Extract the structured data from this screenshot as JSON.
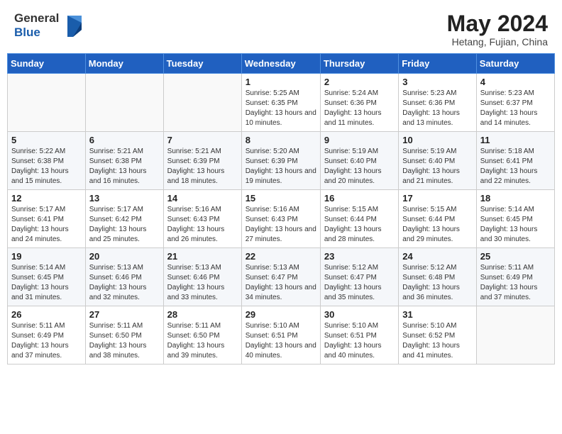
{
  "header": {
    "logo_line1": "General",
    "logo_line2": "Blue",
    "month": "May 2024",
    "location": "Hetang, Fujian, China"
  },
  "weekdays": [
    "Sunday",
    "Monday",
    "Tuesday",
    "Wednesday",
    "Thursday",
    "Friday",
    "Saturday"
  ],
  "weeks": [
    [
      {
        "day": "",
        "text": ""
      },
      {
        "day": "",
        "text": ""
      },
      {
        "day": "",
        "text": ""
      },
      {
        "day": "1",
        "text": "Sunrise: 5:25 AM\nSunset: 6:35 PM\nDaylight: 13 hours and 10 minutes."
      },
      {
        "day": "2",
        "text": "Sunrise: 5:24 AM\nSunset: 6:36 PM\nDaylight: 13 hours and 11 minutes."
      },
      {
        "day": "3",
        "text": "Sunrise: 5:23 AM\nSunset: 6:36 PM\nDaylight: 13 hours and 13 minutes."
      },
      {
        "day": "4",
        "text": "Sunrise: 5:23 AM\nSunset: 6:37 PM\nDaylight: 13 hours and 14 minutes."
      }
    ],
    [
      {
        "day": "5",
        "text": "Sunrise: 5:22 AM\nSunset: 6:38 PM\nDaylight: 13 hours and 15 minutes."
      },
      {
        "day": "6",
        "text": "Sunrise: 5:21 AM\nSunset: 6:38 PM\nDaylight: 13 hours and 16 minutes."
      },
      {
        "day": "7",
        "text": "Sunrise: 5:21 AM\nSunset: 6:39 PM\nDaylight: 13 hours and 18 minutes."
      },
      {
        "day": "8",
        "text": "Sunrise: 5:20 AM\nSunset: 6:39 PM\nDaylight: 13 hours and 19 minutes."
      },
      {
        "day": "9",
        "text": "Sunrise: 5:19 AM\nSunset: 6:40 PM\nDaylight: 13 hours and 20 minutes."
      },
      {
        "day": "10",
        "text": "Sunrise: 5:19 AM\nSunset: 6:40 PM\nDaylight: 13 hours and 21 minutes."
      },
      {
        "day": "11",
        "text": "Sunrise: 5:18 AM\nSunset: 6:41 PM\nDaylight: 13 hours and 22 minutes."
      }
    ],
    [
      {
        "day": "12",
        "text": "Sunrise: 5:17 AM\nSunset: 6:41 PM\nDaylight: 13 hours and 24 minutes."
      },
      {
        "day": "13",
        "text": "Sunrise: 5:17 AM\nSunset: 6:42 PM\nDaylight: 13 hours and 25 minutes."
      },
      {
        "day": "14",
        "text": "Sunrise: 5:16 AM\nSunset: 6:43 PM\nDaylight: 13 hours and 26 minutes."
      },
      {
        "day": "15",
        "text": "Sunrise: 5:16 AM\nSunset: 6:43 PM\nDaylight: 13 hours and 27 minutes."
      },
      {
        "day": "16",
        "text": "Sunrise: 5:15 AM\nSunset: 6:44 PM\nDaylight: 13 hours and 28 minutes."
      },
      {
        "day": "17",
        "text": "Sunrise: 5:15 AM\nSunset: 6:44 PM\nDaylight: 13 hours and 29 minutes."
      },
      {
        "day": "18",
        "text": "Sunrise: 5:14 AM\nSunset: 6:45 PM\nDaylight: 13 hours and 30 minutes."
      }
    ],
    [
      {
        "day": "19",
        "text": "Sunrise: 5:14 AM\nSunset: 6:45 PM\nDaylight: 13 hours and 31 minutes."
      },
      {
        "day": "20",
        "text": "Sunrise: 5:13 AM\nSunset: 6:46 PM\nDaylight: 13 hours and 32 minutes."
      },
      {
        "day": "21",
        "text": "Sunrise: 5:13 AM\nSunset: 6:46 PM\nDaylight: 13 hours and 33 minutes."
      },
      {
        "day": "22",
        "text": "Sunrise: 5:13 AM\nSunset: 6:47 PM\nDaylight: 13 hours and 34 minutes."
      },
      {
        "day": "23",
        "text": "Sunrise: 5:12 AM\nSunset: 6:47 PM\nDaylight: 13 hours and 35 minutes."
      },
      {
        "day": "24",
        "text": "Sunrise: 5:12 AM\nSunset: 6:48 PM\nDaylight: 13 hours and 36 minutes."
      },
      {
        "day": "25",
        "text": "Sunrise: 5:11 AM\nSunset: 6:49 PM\nDaylight: 13 hours and 37 minutes."
      }
    ],
    [
      {
        "day": "26",
        "text": "Sunrise: 5:11 AM\nSunset: 6:49 PM\nDaylight: 13 hours and 37 minutes."
      },
      {
        "day": "27",
        "text": "Sunrise: 5:11 AM\nSunset: 6:50 PM\nDaylight: 13 hours and 38 minutes."
      },
      {
        "day": "28",
        "text": "Sunrise: 5:11 AM\nSunset: 6:50 PM\nDaylight: 13 hours and 39 minutes."
      },
      {
        "day": "29",
        "text": "Sunrise: 5:10 AM\nSunset: 6:51 PM\nDaylight: 13 hours and 40 minutes."
      },
      {
        "day": "30",
        "text": "Sunrise: 5:10 AM\nSunset: 6:51 PM\nDaylight: 13 hours and 40 minutes."
      },
      {
        "day": "31",
        "text": "Sunrise: 5:10 AM\nSunset: 6:52 PM\nDaylight: 13 hours and 41 minutes."
      },
      {
        "day": "",
        "text": ""
      }
    ]
  ]
}
